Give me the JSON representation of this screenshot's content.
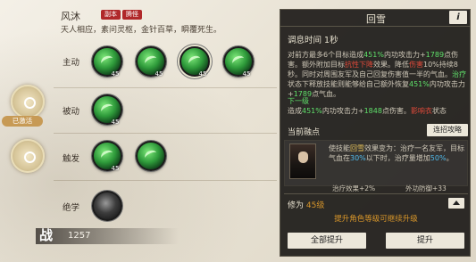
{
  "skill": {
    "name": "风沐",
    "tags": [
      "副本",
      "腾怪"
    ],
    "desc": "天人相应，素问灵枢，金针百草，瞬覆死生。"
  },
  "rows": {
    "active": "主动",
    "passive": "被动",
    "trigger": "触发",
    "ultimate": "绝学"
  },
  "active_levels": [
    "45",
    "45",
    "45",
    "45"
  ],
  "passive_levels": [
    "45"
  ],
  "trigger_levels": [
    "45"
  ],
  "equipped_badge": "已激活",
  "power": {
    "char": "战",
    "value": "1257"
  },
  "panel": {
    "title": "回雪",
    "info_label": "i",
    "tune_time": "调息时间 1秒",
    "desc_parts": [
      {
        "t": "对前方最多6个目标造成",
        "c": ""
      },
      {
        "t": "451%",
        "c": "g"
      },
      {
        "t": "内功攻击力+",
        "c": ""
      },
      {
        "t": "1789",
        "c": "g"
      },
      {
        "t": "点伤害。额外附加目标",
        "c": ""
      },
      {
        "t": "抗性下降",
        "c": "r"
      },
      {
        "t": "效果。降低",
        "c": ""
      },
      {
        "t": "伤害",
        "c": "r"
      },
      {
        "t": "10%持续8秒。同时对周围友军及自己回复伤害值一半的气血。",
        "c": ""
      },
      {
        "t": "治疗",
        "c": "g"
      },
      {
        "t": "状态下释放技能则能够给自己额外恢复",
        "c": ""
      },
      {
        "t": "451%",
        "c": "g"
      },
      {
        "t": "内功攻击力+",
        "c": ""
      },
      {
        "t": "1789",
        "c": "g"
      },
      {
        "t": "点气血。",
        "c": ""
      }
    ],
    "next_label": "下一级",
    "next_parts": [
      {
        "t": "造成",
        "c": ""
      },
      {
        "t": "451%",
        "c": "g"
      },
      {
        "t": "内功攻击力+",
        "c": ""
      },
      {
        "t": "1848",
        "c": "g"
      },
      {
        "t": "点伤害。",
        "c": ""
      },
      {
        "t": "影响衣",
        "c": "r"
      },
      {
        "t": "状态",
        "c": ""
      }
    ],
    "cur_title": "当前融点",
    "link_button": "连招攻略",
    "card_parts": [
      {
        "t": "使技能",
        "c": ""
      },
      {
        "t": "回雪",
        "c": "y"
      },
      {
        "t": "效果变为：治疗一名友军，目标气血在",
        "c": ""
      },
      {
        "t": "30%",
        "c": "b"
      },
      {
        "t": "以下时，治疗量增加",
        "c": ""
      },
      {
        "t": "50%",
        "c": "b"
      },
      {
        "t": "。",
        "c": ""
      }
    ],
    "stat_left": "治疗效果+2%",
    "stat_right": "外功防御+33",
    "level_label": "修为",
    "level_value": "45级",
    "hint": "提升角色等级可继续升级",
    "btn_all": "全部提升",
    "btn_up": "提升"
  }
}
